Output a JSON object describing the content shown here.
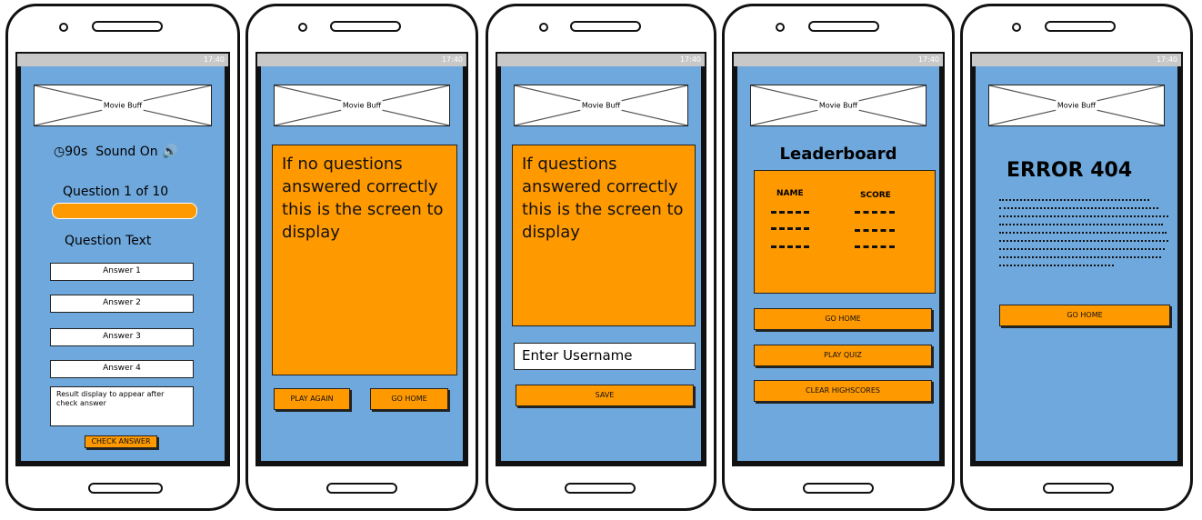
{
  "status_time": "17:40",
  "logo_label": "Movie Buff",
  "screen1": {
    "timer": "90s",
    "sound": "Sound On",
    "question_counter": "Question 1 of 10",
    "question_text": "Question Text",
    "answers": [
      "Answer 1",
      "Answer 2",
      "Answer 3",
      "Answer 4"
    ],
    "result_text": "Result display to appear after check answer",
    "check_button": "CHECK ANSWER"
  },
  "screen2": {
    "message": "If no questions answered correctly this is the screen to display",
    "play_again": "PLAY AGAIN",
    "go_home": "GO HOME"
  },
  "screen3": {
    "message": "If questions answered correctly this is the screen to display",
    "username_placeholder": "Enter Username",
    "save": "SAVE"
  },
  "screen4": {
    "title": "Leaderboard",
    "name_header": "NAME",
    "score_header": "SCORE",
    "go_home": "GO HOME",
    "play_quiz": "PLAY QUIZ",
    "clear": "CLEAR HIGHSCORES"
  },
  "screen5": {
    "title": "ERROR 404",
    "go_home": "GO HOME"
  },
  "colors": {
    "accent": "#ff9900",
    "screen_bg": "#6fa8dc"
  }
}
